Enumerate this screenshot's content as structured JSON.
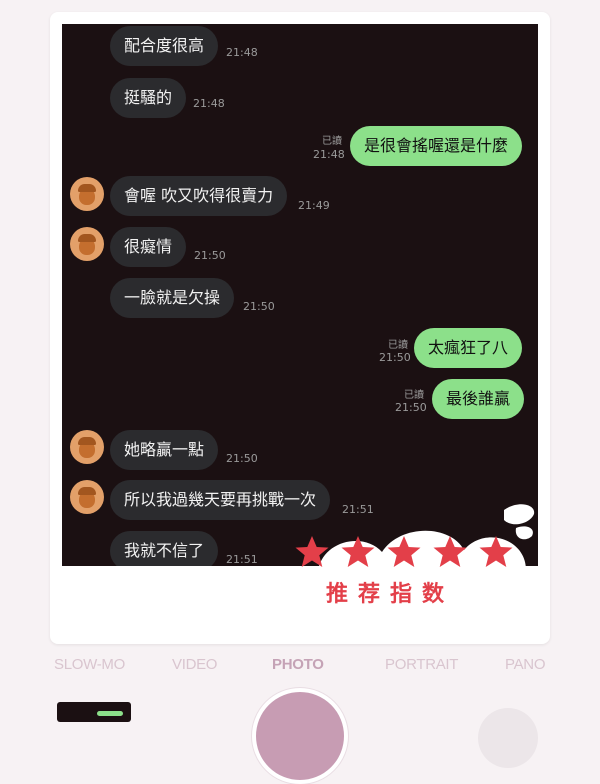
{
  "messages": [
    {
      "side": "left",
      "text": "配合度很高",
      "time": "21:48",
      "avatar": false
    },
    {
      "side": "left",
      "text": "挺騷的",
      "time": "21:48",
      "avatar": false
    },
    {
      "side": "right",
      "text": "是很會搖喔還是什麼",
      "time": "21:48",
      "read": "已讀"
    },
    {
      "side": "left",
      "text": "會喔 吹又吹得很賣力",
      "time": "21:49",
      "avatar": true
    },
    {
      "side": "left",
      "text": "很癡情",
      "time": "21:50",
      "avatar": true
    },
    {
      "side": "left",
      "text": "一臉就是欠操",
      "time": "21:50",
      "avatar": false
    },
    {
      "side": "right",
      "text": "太瘋狂了八",
      "time": "21:50",
      "read": "已讀"
    },
    {
      "side": "right",
      "text": "最後誰贏",
      "time": "21:50",
      "read": "已讀"
    },
    {
      "side": "left",
      "text": "她略贏一點",
      "time": "21:50",
      "avatar": true
    },
    {
      "side": "left",
      "text": "所以我過幾天要再挑戰一次",
      "time": "21:51",
      "avatar": true
    },
    {
      "side": "left",
      "text": "我就不信了",
      "time": "21:51",
      "avatar": false
    }
  ],
  "sticker": {
    "stars": 5,
    "text": "推荐指数"
  },
  "camera": {
    "modes": [
      "SLOW-MO",
      "VIDEO",
      "PHOTO",
      "PORTRAIT",
      "PANO"
    ],
    "active_mode": "PHOTO"
  },
  "colors": {
    "chat_bg": "#1b1012",
    "left_bubble": "#2b2b2e",
    "right_bubble": "#8ce08a",
    "shutter": "#c79cb3",
    "sticker_red": "#e33f49"
  }
}
